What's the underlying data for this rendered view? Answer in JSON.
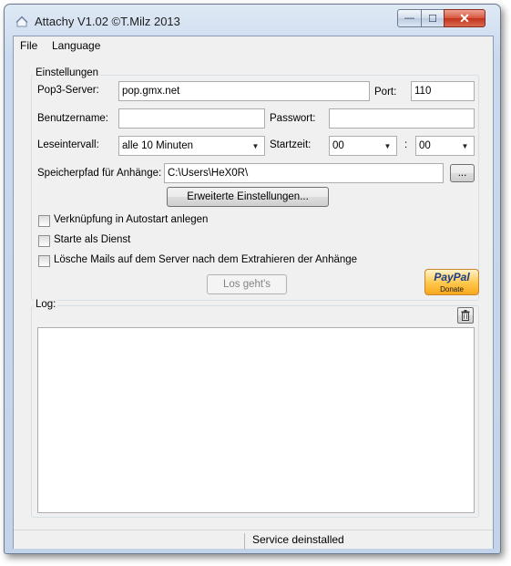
{
  "window": {
    "title": "Attachy V1.02 ©T.Milz 2013",
    "min_glyph": "—",
    "max_glyph": "☐",
    "close_glyph": "✕"
  },
  "menu": {
    "file": "File",
    "language": "Language"
  },
  "settings": {
    "group_label": "Einstellungen",
    "pop3_label": "Pop3-Server:",
    "pop3_value": "pop.gmx.net",
    "port_label": "Port:",
    "port_value": "110",
    "username_label": "Benutzername:",
    "username_value": "",
    "password_label": "Passwort:",
    "password_value": "",
    "interval_label": "Leseintervall:",
    "interval_value": "alle 10 Minuten",
    "starttime_label": "Startzeit:",
    "hour_value": "00",
    "time_separator": ":",
    "minute_value": "00",
    "path_label": "Speicherpfad für Anhänge:",
    "path_value": "C:\\Users\\HeX0R\\",
    "browse_label": "...",
    "advanced_label": "Erweiterte Einstellungen...",
    "autostart_label": "Verknüpfung in Autostart anlegen",
    "service_label": "Starte als Dienst",
    "delete_label": "Lösche Mails auf dem Server nach dem Extrahieren der Anhänge",
    "go_label": "Los geht's",
    "paypal_word": "PayPal",
    "paypal_donate": "Donate"
  },
  "log": {
    "group_label": "Log:",
    "content": ""
  },
  "status": {
    "text": "Service deinstalled"
  },
  "colors": {
    "title_bar": "#c9d9ee",
    "close_button": "#c2331b",
    "paypal_gold": "#ffc74a"
  },
  "icons": {
    "app": "app-icon",
    "dropdown": "chevron-down-icon",
    "trash": "trash-icon",
    "minimize": "minimize-icon",
    "maximize": "maximize-icon",
    "close": "close-icon"
  }
}
